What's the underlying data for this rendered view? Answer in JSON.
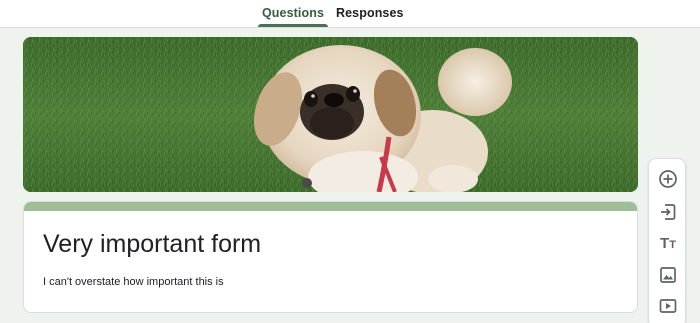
{
  "tabs": {
    "questions": "Questions",
    "responses": "Responses",
    "active": "Questions"
  },
  "header": {
    "image": "dog-photo"
  },
  "form": {
    "title": "Very important form",
    "description": "I can't overstate how important this is"
  },
  "toolbar": {
    "items": [
      {
        "name": "add-question",
        "icon": "add-circle-icon"
      },
      {
        "name": "import-questions",
        "icon": "import-icon"
      },
      {
        "name": "add-title-description",
        "icon": "text-title-icon"
      },
      {
        "name": "add-image",
        "icon": "image-icon"
      },
      {
        "name": "add-video",
        "icon": "video-icon"
      }
    ]
  },
  "colors": {
    "accent": "#4b7153",
    "card_accent": "#9fbe98",
    "background": "#eef3ee"
  }
}
